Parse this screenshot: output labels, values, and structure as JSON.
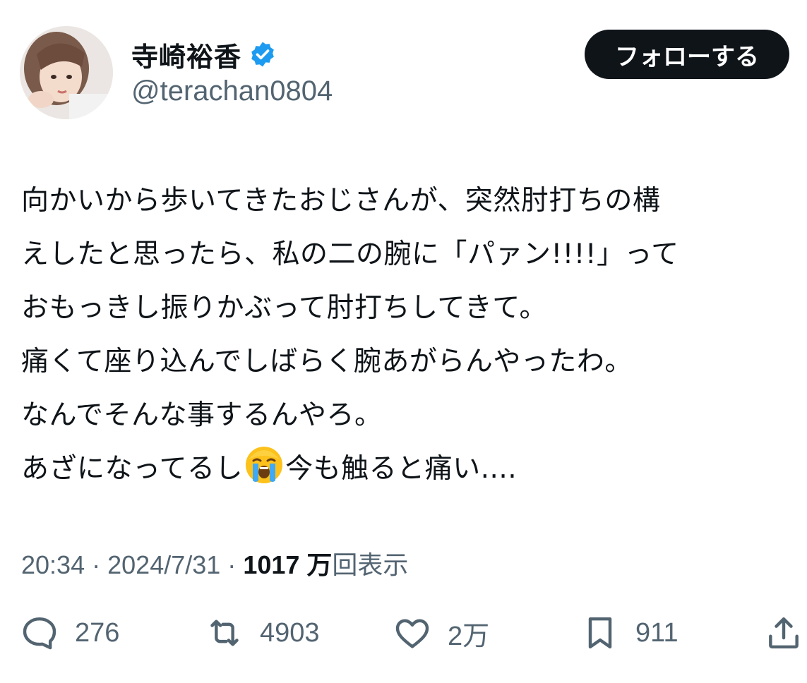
{
  "author": {
    "display_name": "寺崎裕香",
    "handle": "@terachan0804",
    "verified_color": "#1d9bf0"
  },
  "follow_button": {
    "label": "フォローする"
  },
  "tweet": {
    "lines": [
      "向かいから歩いてきたおじさんが、突然肘打ちの構",
      "えしたと思ったら、私の二の腕に「パァン!!!!」って",
      "おもっきし振りかぶって肘打ちしてきて。",
      "痛くて座り込んでしばらく腕あがらんやったわ。",
      "なんでそんな事するんやろ。"
    ],
    "last_line_before_emoji": "あざになってるし",
    "emoji_icon": "loudly-crying-face-emoji",
    "last_line_after_emoji": "今も触ると痛い...."
  },
  "meta": {
    "time": "20:34",
    "separator": "·",
    "date": "2024/7/31",
    "views_count": "1017 万",
    "views_label": "回表示"
  },
  "actions": {
    "reply": {
      "icon": "reply-bubble-icon",
      "count": "276"
    },
    "retweet": {
      "icon": "retweet-icon",
      "count": "4903"
    },
    "like": {
      "icon": "heart-icon",
      "count": "2万"
    },
    "bookmark": {
      "icon": "bookmark-icon",
      "count": "911"
    },
    "share": {
      "icon": "share-icon"
    }
  },
  "colors": {
    "text_primary": "#0f1419",
    "text_secondary": "#536471",
    "follow_button_bg": "#0f1419",
    "follow_button_text": "#ffffff"
  }
}
